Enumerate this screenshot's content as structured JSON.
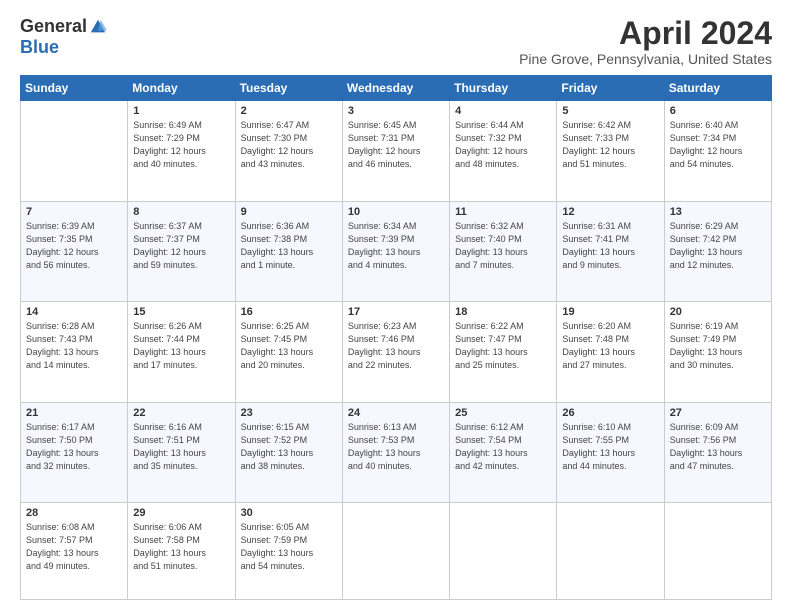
{
  "logo": {
    "general": "General",
    "blue": "Blue"
  },
  "header": {
    "month": "April 2024",
    "location": "Pine Grove, Pennsylvania, United States"
  },
  "weekdays": [
    "Sunday",
    "Monday",
    "Tuesday",
    "Wednesday",
    "Thursday",
    "Friday",
    "Saturday"
  ],
  "weeks": [
    [
      {
        "day": "",
        "info": ""
      },
      {
        "day": "1",
        "info": "Sunrise: 6:49 AM\nSunset: 7:29 PM\nDaylight: 12 hours\nand 40 minutes."
      },
      {
        "day": "2",
        "info": "Sunrise: 6:47 AM\nSunset: 7:30 PM\nDaylight: 12 hours\nand 43 minutes."
      },
      {
        "day": "3",
        "info": "Sunrise: 6:45 AM\nSunset: 7:31 PM\nDaylight: 12 hours\nand 46 minutes."
      },
      {
        "day": "4",
        "info": "Sunrise: 6:44 AM\nSunset: 7:32 PM\nDaylight: 12 hours\nand 48 minutes."
      },
      {
        "day": "5",
        "info": "Sunrise: 6:42 AM\nSunset: 7:33 PM\nDaylight: 12 hours\nand 51 minutes."
      },
      {
        "day": "6",
        "info": "Sunrise: 6:40 AM\nSunset: 7:34 PM\nDaylight: 12 hours\nand 54 minutes."
      }
    ],
    [
      {
        "day": "7",
        "info": "Sunrise: 6:39 AM\nSunset: 7:35 PM\nDaylight: 12 hours\nand 56 minutes."
      },
      {
        "day": "8",
        "info": "Sunrise: 6:37 AM\nSunset: 7:37 PM\nDaylight: 12 hours\nand 59 minutes."
      },
      {
        "day": "9",
        "info": "Sunrise: 6:36 AM\nSunset: 7:38 PM\nDaylight: 13 hours\nand 1 minute."
      },
      {
        "day": "10",
        "info": "Sunrise: 6:34 AM\nSunset: 7:39 PM\nDaylight: 13 hours\nand 4 minutes."
      },
      {
        "day": "11",
        "info": "Sunrise: 6:32 AM\nSunset: 7:40 PM\nDaylight: 13 hours\nand 7 minutes."
      },
      {
        "day": "12",
        "info": "Sunrise: 6:31 AM\nSunset: 7:41 PM\nDaylight: 13 hours\nand 9 minutes."
      },
      {
        "day": "13",
        "info": "Sunrise: 6:29 AM\nSunset: 7:42 PM\nDaylight: 13 hours\nand 12 minutes."
      }
    ],
    [
      {
        "day": "14",
        "info": "Sunrise: 6:28 AM\nSunset: 7:43 PM\nDaylight: 13 hours\nand 14 minutes."
      },
      {
        "day": "15",
        "info": "Sunrise: 6:26 AM\nSunset: 7:44 PM\nDaylight: 13 hours\nand 17 minutes."
      },
      {
        "day": "16",
        "info": "Sunrise: 6:25 AM\nSunset: 7:45 PM\nDaylight: 13 hours\nand 20 minutes."
      },
      {
        "day": "17",
        "info": "Sunrise: 6:23 AM\nSunset: 7:46 PM\nDaylight: 13 hours\nand 22 minutes."
      },
      {
        "day": "18",
        "info": "Sunrise: 6:22 AM\nSunset: 7:47 PM\nDaylight: 13 hours\nand 25 minutes."
      },
      {
        "day": "19",
        "info": "Sunrise: 6:20 AM\nSunset: 7:48 PM\nDaylight: 13 hours\nand 27 minutes."
      },
      {
        "day": "20",
        "info": "Sunrise: 6:19 AM\nSunset: 7:49 PM\nDaylight: 13 hours\nand 30 minutes."
      }
    ],
    [
      {
        "day": "21",
        "info": "Sunrise: 6:17 AM\nSunset: 7:50 PM\nDaylight: 13 hours\nand 32 minutes."
      },
      {
        "day": "22",
        "info": "Sunrise: 6:16 AM\nSunset: 7:51 PM\nDaylight: 13 hours\nand 35 minutes."
      },
      {
        "day": "23",
        "info": "Sunrise: 6:15 AM\nSunset: 7:52 PM\nDaylight: 13 hours\nand 38 minutes."
      },
      {
        "day": "24",
        "info": "Sunrise: 6:13 AM\nSunset: 7:53 PM\nDaylight: 13 hours\nand 40 minutes."
      },
      {
        "day": "25",
        "info": "Sunrise: 6:12 AM\nSunset: 7:54 PM\nDaylight: 13 hours\nand 42 minutes."
      },
      {
        "day": "26",
        "info": "Sunrise: 6:10 AM\nSunset: 7:55 PM\nDaylight: 13 hours\nand 44 minutes."
      },
      {
        "day": "27",
        "info": "Sunrise: 6:09 AM\nSunset: 7:56 PM\nDaylight: 13 hours\nand 47 minutes."
      }
    ],
    [
      {
        "day": "28",
        "info": "Sunrise: 6:08 AM\nSunset: 7:57 PM\nDaylight: 13 hours\nand 49 minutes."
      },
      {
        "day": "29",
        "info": "Sunrise: 6:06 AM\nSunset: 7:58 PM\nDaylight: 13 hours\nand 51 minutes."
      },
      {
        "day": "30",
        "info": "Sunrise: 6:05 AM\nSunset: 7:59 PM\nDaylight: 13 hours\nand 54 minutes."
      },
      {
        "day": "",
        "info": ""
      },
      {
        "day": "",
        "info": ""
      },
      {
        "day": "",
        "info": ""
      },
      {
        "day": "",
        "info": ""
      }
    ]
  ]
}
